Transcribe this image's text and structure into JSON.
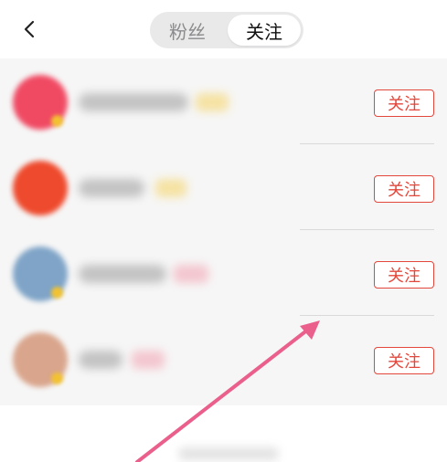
{
  "header": {
    "tabs": [
      {
        "label": "粉丝",
        "selected": false
      },
      {
        "label": "关注",
        "selected": true
      }
    ]
  },
  "list": {
    "items": [
      {
        "follow_label": "关注",
        "avatar_color": "#f04a63",
        "level_color": "#f5d56b"
      },
      {
        "follow_label": "关注",
        "avatar_color": "#ee4a2d",
        "level_color": "#f5d56b"
      },
      {
        "follow_label": "关注",
        "avatar_color": "#7fa4c7",
        "level_color": "#f2a7b5"
      },
      {
        "follow_label": "关注",
        "avatar_color": "#d9a58c",
        "level_color": "#f2a7b5"
      }
    ]
  },
  "colors": {
    "accent": "#e3473c",
    "annotation_arrow": "#ea5f8c"
  },
  "icons": {
    "back": "chevron-left-icon",
    "arrow": "annotation-arrow-icon"
  }
}
